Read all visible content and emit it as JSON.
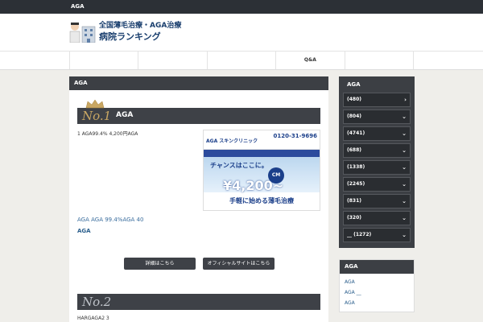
{
  "topbar": {
    "title": "AGA"
  },
  "header": {
    "logo_line1": "全国薄毛治療・AGA治療",
    "logo_line2": "病院ランキング"
  },
  "nav": {
    "items": [
      "",
      "",
      "",
      "Q&A",
      ""
    ]
  },
  "main": {
    "heading": "AGA",
    "rank1": {
      "no": "No.1",
      "name": "AGA",
      "desc": "1 AGA99.4% 4,200円AGA",
      "banner": {
        "brand": "AGA スキンクリニック",
        "tel": "0120-31-9696",
        "catch": "チャンスはここに。",
        "cm": "CM",
        "price": "¥4,200~",
        "bottom": "手軽に始める薄毛治療"
      },
      "sub_text": "AGA AGA 99.4%AGA 40",
      "sub_bold": "AGA",
      "btn_detail": "詳細はこちら",
      "btn_official": "オフィシャルサイトはこちら"
    },
    "rank2": {
      "no": "No.2",
      "desc": "HARGAGA2 3"
    }
  },
  "sidebar": {
    "heading": "AGA",
    "items": [
      "(480)",
      "(804)",
      "(4741)",
      "(688)",
      "(1338)",
      "(2245)",
      "(831)",
      "(320)",
      "__ (1272)"
    ],
    "heading2": "AGA",
    "links": [
      "AGA",
      "AGA __",
      "AGA"
    ]
  },
  "colors": {
    "dark": "#3c3f44",
    "accent_gold": "#c9a763",
    "link": "#2a5e8c"
  }
}
